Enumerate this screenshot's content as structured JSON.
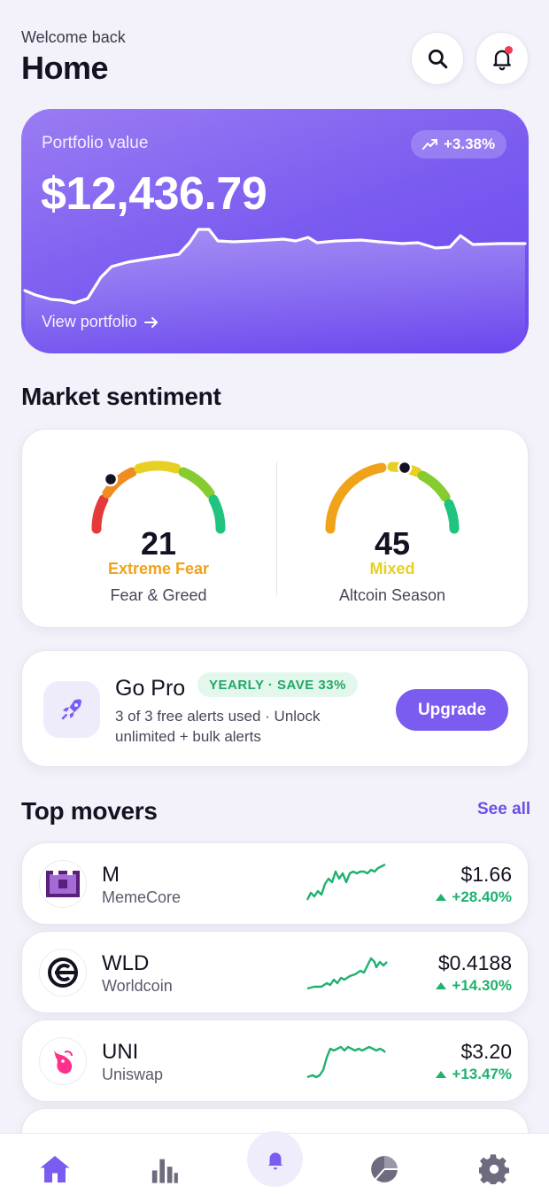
{
  "header": {
    "welcome": "Welcome back",
    "title": "Home"
  },
  "portfolio": {
    "label": "Portfolio value",
    "value": "$12,436.79",
    "change": "+3.38%",
    "link": "View portfolio"
  },
  "sentiment": {
    "title": "Market sentiment",
    "fear_greed": {
      "value": "21",
      "status": "Extreme Fear",
      "caption": "Fear & Greed",
      "status_color": "#f0a21a"
    },
    "altcoin": {
      "value": "45",
      "status": "Mixed",
      "caption": "Altcoin Season",
      "status_color": "#e8cf24"
    }
  },
  "gopro": {
    "title": "Go Pro",
    "badge": "YEARLY · SAVE 33%",
    "desc": "3 of 3 free alerts used · Unlock unlimited + bulk alerts",
    "button": "Upgrade"
  },
  "movers": {
    "title": "Top movers",
    "see_all": "See all",
    "items": [
      {
        "symbol": "M",
        "name": "MemeCore",
        "price": "$1.66",
        "change": "+28.40%",
        "icon": "memecore-icon"
      },
      {
        "symbol": "WLD",
        "name": "Worldcoin",
        "price": "$0.4188",
        "change": "+14.30%",
        "icon": "worldcoin-icon"
      },
      {
        "symbol": "UNI",
        "name": "Uniswap",
        "price": "$3.20",
        "change": "+13.47%",
        "icon": "uniswap-icon"
      }
    ]
  },
  "nav": {
    "items": [
      "home-icon",
      "markets-icon",
      "alerts-icon",
      "portfolio-icon",
      "settings-icon"
    ],
    "accent": "#7b5cf0",
    "inactive": "#6e6b7f"
  }
}
